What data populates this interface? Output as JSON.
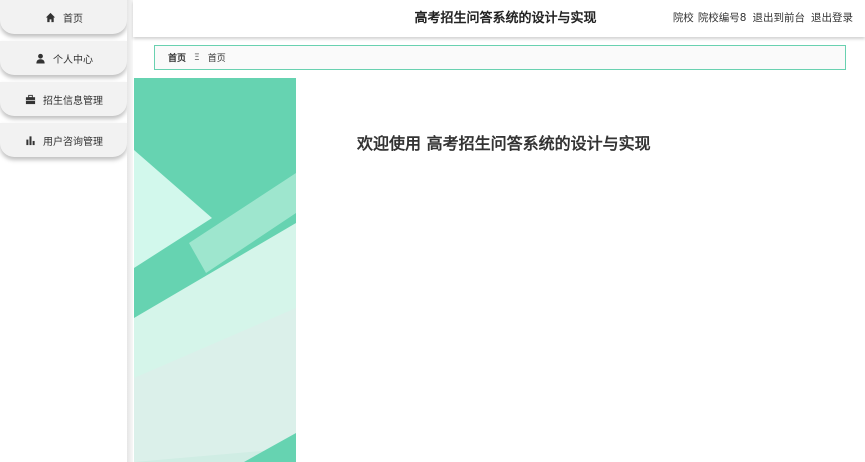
{
  "header": {
    "title": "高考招生问答系统的设计与实现",
    "role": "院校",
    "username": "院校编号8",
    "back_to_front": "退出到前台",
    "logout": "退出登录"
  },
  "sidebar": {
    "items": [
      {
        "label": "首页",
        "icon": "home-icon"
      },
      {
        "label": "个人中心",
        "icon": "user-icon"
      },
      {
        "label": "招生信息管理",
        "icon": "briefcase-icon"
      },
      {
        "label": "用户咨询管理",
        "icon": "bar-chart-icon"
      }
    ]
  },
  "breadcrumb": {
    "home": "首页",
    "separator": "Ξ",
    "current": "首页"
  },
  "welcome": {
    "prefix": "欢迎使用",
    "title": "高考招生问答系统的设计与实现"
  },
  "colors": {
    "accent": "#69d1b0",
    "deco_dark": "#66d3b1",
    "deco_light": "#d2f8ec"
  }
}
